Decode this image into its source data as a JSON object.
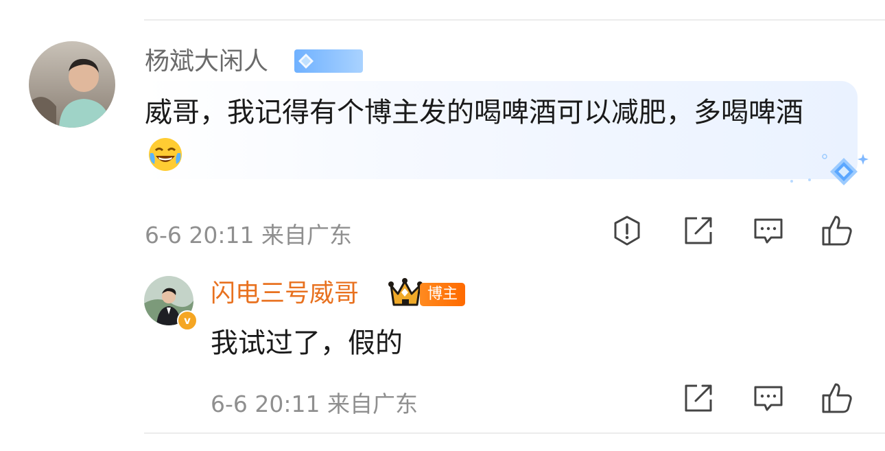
{
  "comment": {
    "username": "杨斌大闲人",
    "text": "威哥，我记得有个博主发的喝啤酒可以减肥，多喝啤酒",
    "emoji": "laughing-tears-emoji",
    "meta": "6-6 20:11 来自广东",
    "actions": [
      "report-icon",
      "share-icon",
      "comment-icon",
      "like-icon"
    ]
  },
  "reply": {
    "username": "闪电三号威哥",
    "badge_label": "博主",
    "verified_mark": "v",
    "text": "我试过了，假的",
    "meta": "6-6 20:11 来自广东",
    "actions": [
      "share-icon",
      "comment-icon",
      "like-icon"
    ]
  },
  "colors": {
    "reply_username": "#e8711f",
    "meta_text": "#8f8f8f",
    "vip_badge": "#6fb1ff"
  }
}
